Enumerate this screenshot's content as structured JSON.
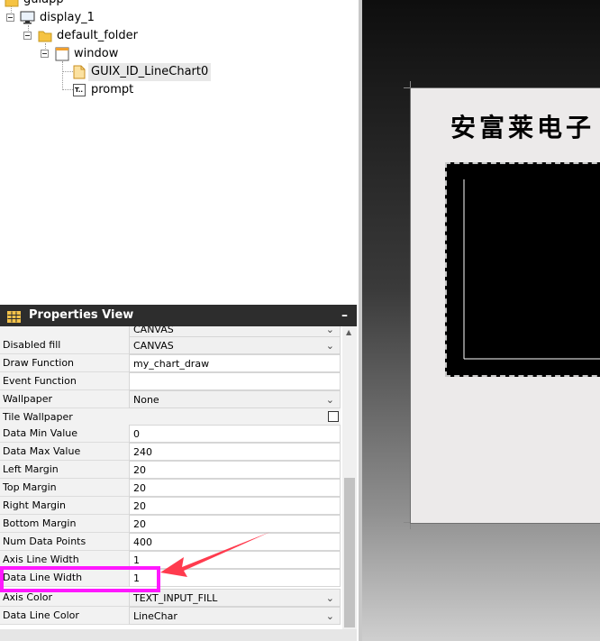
{
  "tree": {
    "items": [
      {
        "label": "guiapp"
      },
      {
        "label": "display_1"
      },
      {
        "label": "default_folder"
      },
      {
        "label": "window"
      },
      {
        "label": "GUIX_ID_LineChart0"
      },
      {
        "label": "prompt"
      }
    ],
    "prompt_icon_text": "T.."
  },
  "properties": {
    "title": "Properties View",
    "minimize_glyph": "–",
    "rows": [
      {
        "name": "",
        "value": "CANVAS",
        "type": "combo"
      },
      {
        "name": "Disabled fill",
        "value": "CANVAS",
        "type": "combo"
      },
      {
        "name": "Draw Function",
        "value": "my_chart_draw",
        "type": "text"
      },
      {
        "name": "Event Function",
        "value": "",
        "type": "text"
      },
      {
        "name": "Wallpaper",
        "value": "None",
        "type": "combo"
      },
      {
        "name": "Tile Wallpaper",
        "value": "",
        "type": "checkbox",
        "checked": false
      },
      {
        "name": "Data Min Value",
        "value": "0",
        "type": "text"
      },
      {
        "name": "Data Max Value",
        "value": "240",
        "type": "text"
      },
      {
        "name": "Left Margin",
        "value": "20",
        "type": "text"
      },
      {
        "name": "Top Margin",
        "value": "20",
        "type": "text"
      },
      {
        "name": "Right Margin",
        "value": "20",
        "type": "text"
      },
      {
        "name": "Bottom Margin",
        "value": "20",
        "type": "text"
      },
      {
        "name": "Num Data Points",
        "value": "400",
        "type": "text"
      },
      {
        "name": "Axis Line Width",
        "value": "1",
        "type": "text"
      },
      {
        "name": "Data Line Width",
        "value": "1",
        "type": "text"
      },
      {
        "name": "Axis Color",
        "value": "TEXT_INPUT_FILL",
        "type": "combo"
      },
      {
        "name": "Data Line Color",
        "value": "LineChar",
        "type": "combo"
      }
    ],
    "highlighted_row": "Data Line Width"
  },
  "canvas": {
    "prompt_text": "安富莱电子"
  },
  "colors": {
    "highlight": "#ff18ff",
    "arrow": "#ff3b4e",
    "panel_header": "#2d2d2d"
  },
  "icons": {
    "app": "folder-icon",
    "display": "monitor-icon",
    "folder": "folder-icon",
    "window": "window-icon",
    "chart": "document-icon",
    "prompt": "text-prompt-icon"
  }
}
